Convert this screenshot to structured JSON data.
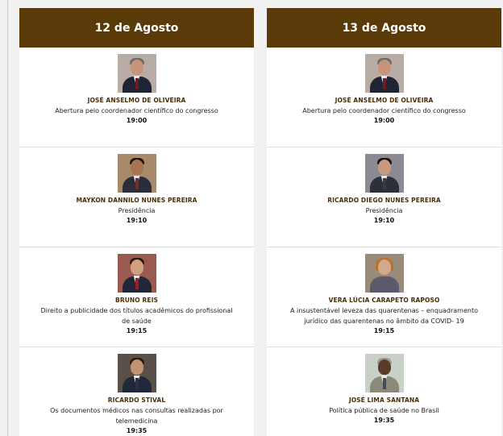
{
  "days": [
    {
      "title": "12 de Agosto",
      "sessions": [
        {
          "name": "JOSÉ ANSELMO DE OLIVEIRA",
          "desc": "Abertura pelo coordenador científico do congresso",
          "time": "19:00"
        },
        {
          "name": "MAYKON DANNILO NUNES PEREIRA",
          "desc": "Presidência",
          "time": "19:10"
        },
        {
          "name": "BRUNO REIS",
          "desc": "Direito a publicidade dos títulos acadêmicos do profissional de saúde",
          "time": "19:15"
        },
        {
          "name": "RICARDO STIVAL",
          "desc": "Os documentos médicos nas consultas realizadas por telemedicina",
          "time": "19:35"
        }
      ]
    },
    {
      "title": "13 de Agosto",
      "sessions": [
        {
          "name": "JOSÉ ANSELMO DE OLIVEIRA",
          "desc": "Abertura pelo coordenador científico do congresso",
          "time": "19:00"
        },
        {
          "name": "RICARDO DIEGO NUNES PEREIRA",
          "desc": "Presidência",
          "time": "19:10"
        },
        {
          "name": "VERA LÚCIA CARAPETO RAPOSO",
          "desc": "A insustentável leveza das quarentenas – enquadramento jurídico das quarentenas no âmbito da COVID- 19",
          "time": "19:15"
        },
        {
          "name": "JOSÉ LIMA SANTANA",
          "desc": "Política pública de saúde no Brasil",
          "time": "19:35"
        }
      ]
    }
  ],
  "colors": {
    "header": "#5a3a08",
    "name": "#4a2e06"
  }
}
